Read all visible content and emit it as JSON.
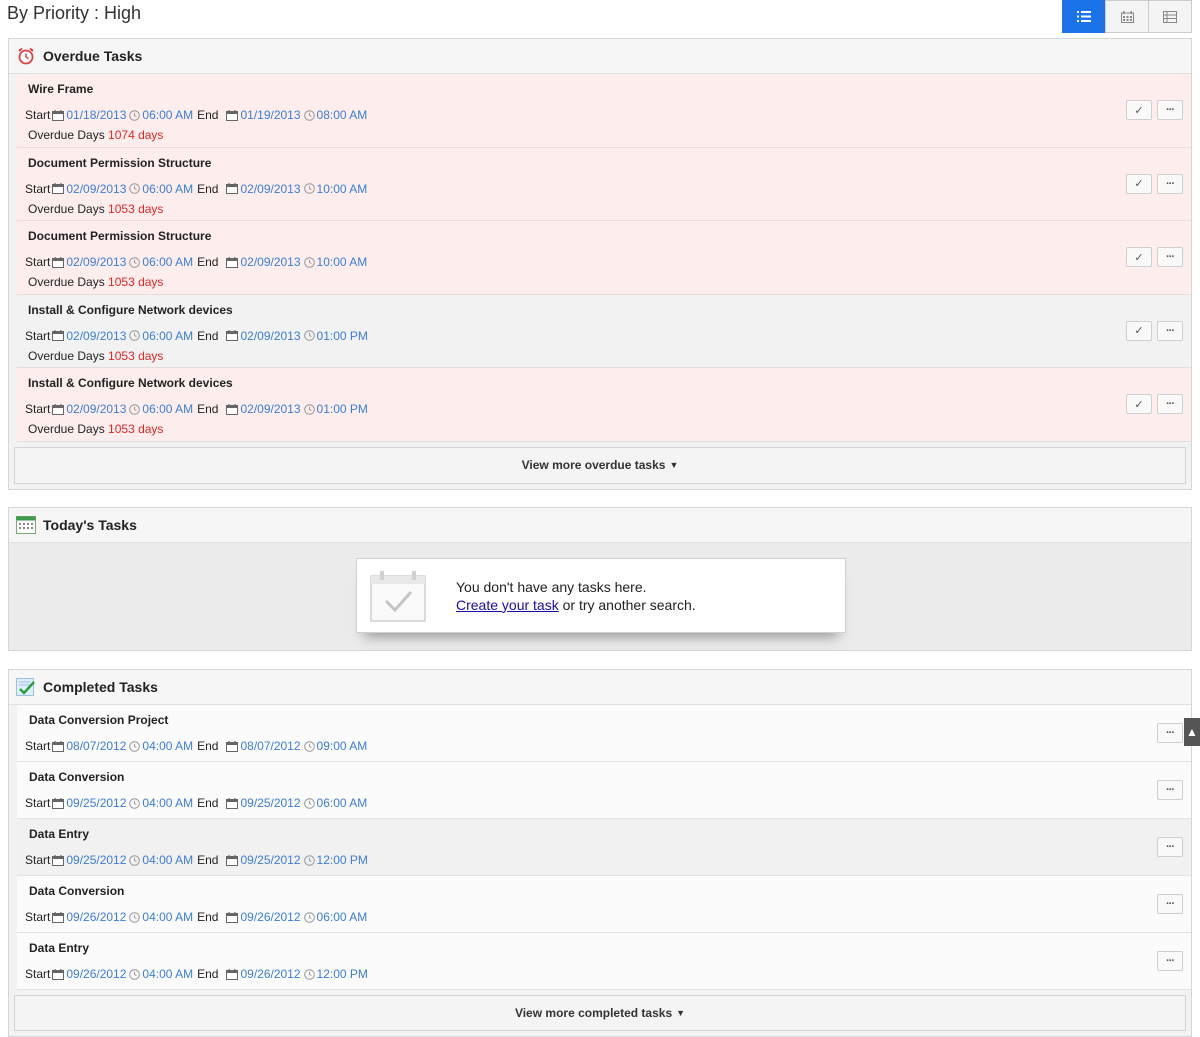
{
  "header": {
    "title": "By Priority : High"
  },
  "view_toggle": [
    {
      "name": "list",
      "icon": "list-icon",
      "active": true
    },
    {
      "name": "calendar",
      "icon": "calendar-icon",
      "active": false
    },
    {
      "name": "table",
      "icon": "table-icon",
      "active": false
    }
  ],
  "common": {
    "start": "Start",
    "end": "End",
    "overdue_days": "Overdue Days"
  },
  "overdue": {
    "title": "Overdue Tasks",
    "tasks": [
      {
        "name": "Wire Frame",
        "start_date": "01/18/2013",
        "start_time": "06:00 AM",
        "end_date": "01/19/2013",
        "end_time": "08:00 AM",
        "days": "1074 days"
      },
      {
        "name": "Document Permission Structure",
        "start_date": "02/09/2013",
        "start_time": "06:00 AM",
        "end_date": "02/09/2013",
        "end_time": "10:00 AM",
        "days": "1053 days"
      },
      {
        "name": "Document Permission Structure",
        "start_date": "02/09/2013",
        "start_time": "06:00 AM",
        "end_date": "02/09/2013",
        "end_time": "10:00 AM",
        "days": "1053 days"
      },
      {
        "name": "Install & Configure Network devices",
        "start_date": "02/09/2013",
        "start_time": "06:00 AM",
        "end_date": "02/09/2013",
        "end_time": "01:00 PM",
        "days": "1053 days"
      },
      {
        "name": "Install & Configure Network devices",
        "start_date": "02/09/2013",
        "start_time": "06:00 AM",
        "end_date": "02/09/2013",
        "end_time": "01:00 PM",
        "days": "1053 days"
      }
    ],
    "more_label": "View more overdue tasks"
  },
  "today": {
    "title": "Today's Tasks",
    "empty_line1": "You don't have any tasks here.",
    "empty_link": "Create your task",
    "empty_line2_rest": " or try another search."
  },
  "completed": {
    "title": "Completed Tasks",
    "tasks": [
      {
        "name": "Data Conversion Project",
        "start_date": "08/07/2012",
        "start_time": "04:00 AM",
        "end_date": "08/07/2012",
        "end_time": "09:00 AM"
      },
      {
        "name": "Data Conversion",
        "start_date": "09/25/2012",
        "start_time": "04:00 AM",
        "end_date": "09/25/2012",
        "end_time": "06:00 AM"
      },
      {
        "name": "Data Entry",
        "start_date": "09/25/2012",
        "start_time": "04:00 AM",
        "end_date": "09/25/2012",
        "end_time": "12:00 PM"
      },
      {
        "name": "Data Conversion",
        "start_date": "09/26/2012",
        "start_time": "04:00 AM",
        "end_date": "09/26/2012",
        "end_time": "06:00 AM"
      },
      {
        "name": "Data Entry",
        "start_date": "09/26/2012",
        "start_time": "04:00 AM",
        "end_date": "09/26/2012",
        "end_time": "12:00 PM"
      }
    ],
    "more_label": "View more completed tasks"
  },
  "icons": {
    "complete": "check-icon",
    "more": "more-options-icon",
    "scroll_top": "scroll-top-icon"
  },
  "colors": {
    "accent": "#1a73e8",
    "link": "#3b7dd8",
    "overdue_red": "#e32626",
    "overdue_bg": "#fdeeed"
  }
}
